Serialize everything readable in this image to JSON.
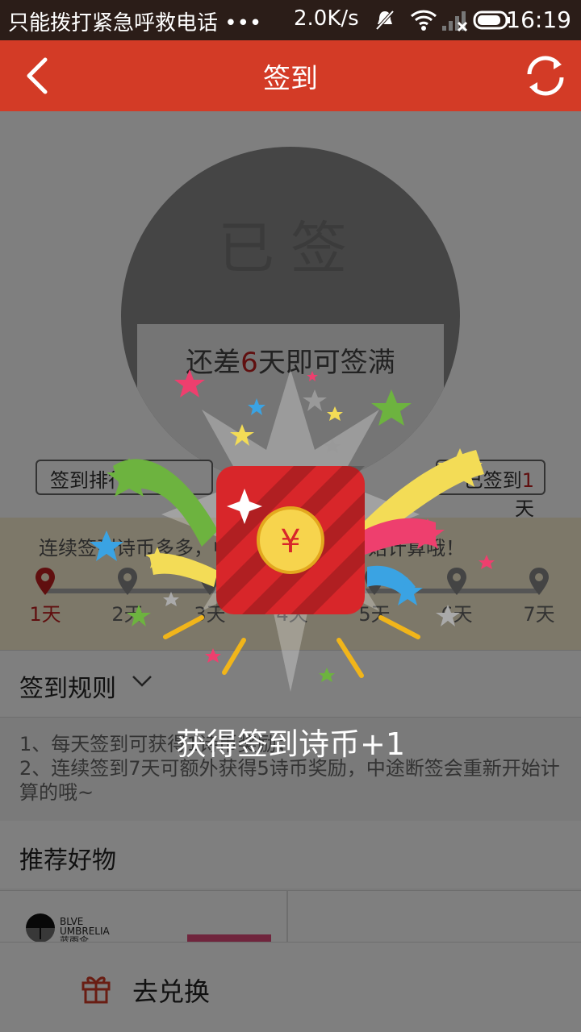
{
  "status_bar": {
    "carrier": "只能拨打紧急呼救电话 •••",
    "speed": "2.0K/s",
    "time": "16:19"
  },
  "header": {
    "title": "签到"
  },
  "sign": {
    "signed_label": "已签",
    "remain_prefix": "还差",
    "remain_days": "6",
    "remain_suffix": "天即可签满",
    "rank_button": "签到排行",
    "days_prefix": "已签到",
    "days_count": "1",
    "days_suffix": "天"
  },
  "streak": {
    "tip": "连续签到诗币多多，中途断签会重新开始计算哦！",
    "days": [
      "1天",
      "2天",
      "3天",
      "4天",
      "5天",
      "6天",
      "7天"
    ],
    "active_index": 0
  },
  "rules": {
    "heading": "签到规则",
    "line1": "1、每天签到可获得1诗币奖励；",
    "line2": "2、连续签到7天可额外获得5诗币奖励，中途断签会重新开始计算的哦~"
  },
  "recommend": {
    "heading": "推荐好物",
    "brand_line1": "BLVE",
    "brand_line2": "UMBRELIA",
    "brand_line3": "蓝雨伞"
  },
  "bottom": {
    "exchange_label": "去兑换"
  },
  "reward": {
    "text": "获得签到诗币+1",
    "coin_symbol": "¥"
  },
  "colors": {
    "header_red": "#d33b26",
    "status_bar": "#2b1d18",
    "accent_red": "#c01e1e"
  }
}
